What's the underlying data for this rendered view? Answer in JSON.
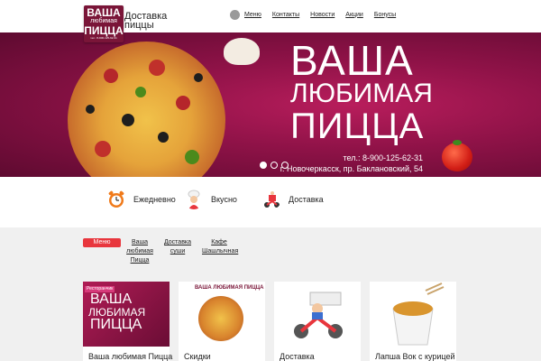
{
  "header": {
    "logo": {
      "line1": "ВАША",
      "line2": "любимая",
      "line3": "ПИЦЦА",
      "line4": "тел.: 8-900-125-62-31"
    },
    "brand_title": "Доставка пиццы",
    "nav": [
      {
        "label": "Меню"
      },
      {
        "label": "Контакты"
      },
      {
        "label": "Новости"
      },
      {
        "label": "Акции"
      },
      {
        "label": "Бонусы"
      }
    ]
  },
  "banner": {
    "title_line1": "ВАША",
    "title_line2": "ЛЮБИМАЯ",
    "title_line3": "ПИЦЦА",
    "phone": "тел.: 8-900-125-62-31",
    "address": "г. Новочеркасск, пр. Баклановский, 54",
    "slides_total": 3,
    "slide_active": 1
  },
  "features": [
    {
      "label": "Ежедневно",
      "icon": "alarm-clock-icon",
      "color": "#f07a1a"
    },
    {
      "label": "Вкусно",
      "icon": "chef-icon",
      "color": "#d8d8d8"
    },
    {
      "label": "Доставка",
      "icon": "scooter-icon",
      "color": "#e8363d"
    }
  ],
  "tabs": {
    "active": "Меню",
    "items": [
      {
        "label": "Ваша любимая Пицца"
      },
      {
        "label": "Доставка суши"
      },
      {
        "label": "Кафе Шашлычная"
      }
    ]
  },
  "cards": [
    {
      "title": "Ваша любимая Пицца",
      "badge": "Ресторанчик",
      "thumb_line1": "ВАША",
      "thumb_line2": "ЛЮБИМАЯ",
      "thumb_line3": "ПИЦЦА"
    },
    {
      "title": "Скидки",
      "thumb_line1": "ВАША ЛЮБИМАЯ ПИЦЦА"
    },
    {
      "title": "Доставка"
    },
    {
      "title": "Лапша Вок с курицей"
    }
  ],
  "colors": {
    "accent": "#e8363d",
    "banner": "#8e1247"
  }
}
